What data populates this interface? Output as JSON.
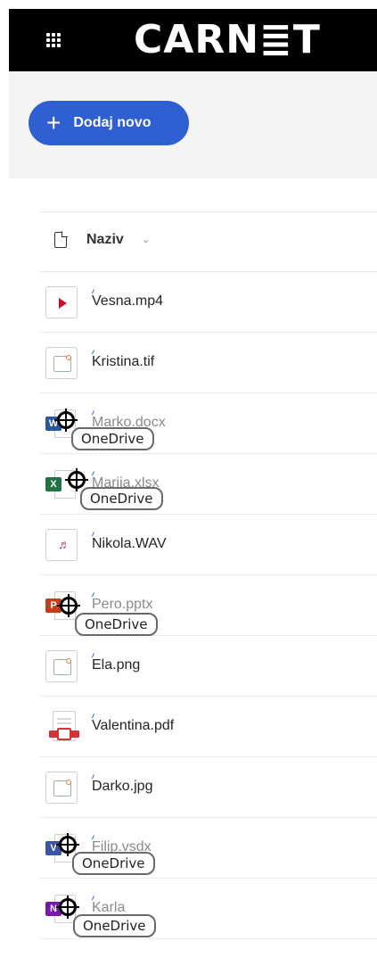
{
  "header": {
    "brand": "CARN≣T",
    "waffle_icon": "app-launcher-icon"
  },
  "toolbar": {
    "new_button_icon": "+",
    "new_button_label": "Dodaj novo"
  },
  "list": {
    "column_header": {
      "icon": "document-icon",
      "label": "Naziv",
      "sort_icon": "⌄"
    },
    "files": [
      {
        "name": "Vesna.mp4",
        "icon": "video-file-icon"
      },
      {
        "name": "Kristina.tif",
        "icon": "image-file-icon"
      },
      {
        "name": "Marko.docx",
        "icon": "word-file-icon",
        "tile": "W"
      },
      {
        "name": "Marija.xlsx",
        "icon": "excel-file-icon",
        "tile": "X"
      },
      {
        "name": "Nikola.WAV",
        "icon": "audio-file-icon"
      },
      {
        "name": "Pero.pptx",
        "icon": "powerpoint-file-icon",
        "tile": "P"
      },
      {
        "name": "Ela.png",
        "icon": "image-file-icon"
      },
      {
        "name": "Valentina.pdf",
        "icon": "pdf-file-icon"
      },
      {
        "name": "Darko.jpg",
        "icon": "image-file-icon"
      },
      {
        "name": "Filip.vsdx",
        "icon": "visio-file-icon",
        "tile": "V"
      },
      {
        "name": "Karla",
        "icon": "onenote-file-icon",
        "tile": "N"
      }
    ],
    "new_marker": "⸝"
  },
  "overlay": {
    "label": "OneDrive"
  },
  "colors": {
    "accent": "#2f5fd0",
    "word": "#2b579a",
    "excel": "#217346",
    "powerpoint": "#c43e1c",
    "visio": "#3955a3",
    "onenote": "#7719aa"
  }
}
